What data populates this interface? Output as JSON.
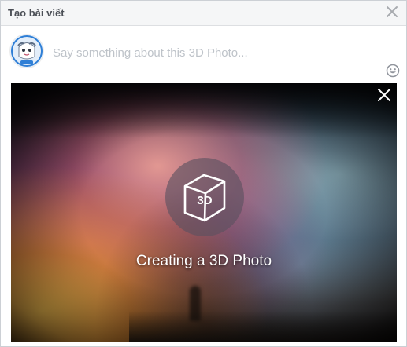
{
  "dialog": {
    "title": "Tạo bài viết",
    "close_icon": "close-icon"
  },
  "composer": {
    "avatar_icon": "avatar",
    "placeholder": "Say something about this 3D Photo...",
    "value": "",
    "emoji_icon": "smiley-icon"
  },
  "media": {
    "close_icon": "close-icon",
    "badge_label": "3D",
    "caption": "Creating a 3D Photo"
  },
  "colors": {
    "header_bg": "#f5f6f7",
    "title_text": "#4b4f56",
    "placeholder_text": "#bec3c9",
    "caption_text": "#ffffff"
  }
}
